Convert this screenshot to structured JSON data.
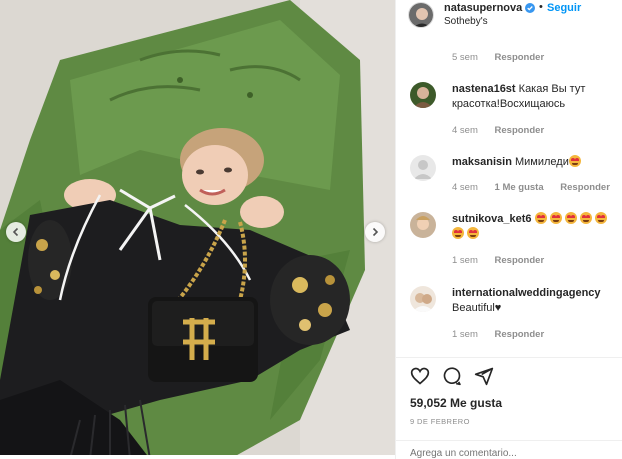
{
  "header": {
    "username": "natasupernova",
    "follow_label": "Seguir",
    "separator": "•",
    "location": "Sotheby's"
  },
  "caption_meta": {
    "time": "5 sem",
    "reply": "Responder"
  },
  "comments": [
    {
      "username": "nastena16st",
      "text": "Какая Вы тут красотка!Восхищаюсь",
      "time": "4 sem",
      "reply": "Responder"
    },
    {
      "username": "maksanisin",
      "text": "Мимиледи",
      "time": "4 sem",
      "likes": "1 Me gusta",
      "reply": "Responder"
    },
    {
      "username": "sutnikova_ket6",
      "text": "",
      "time": "1 sem",
      "reply": "Responder"
    },
    {
      "username": "internationalweddingagency",
      "text": "Beautiful♥",
      "time": "1 sem",
      "reply": "Responder"
    }
  ],
  "likes_count": "59,052 Me gusta",
  "post_date": "9 DE FEBRERO",
  "comment_input": {
    "placeholder": "Agrega un comentario..."
  },
  "icons": [
    "verified-badge-icon",
    "heart-icon",
    "comment-icon",
    "share-icon",
    "chevron-left-icon",
    "chevron-right-icon",
    "heart-eyes-emoji"
  ],
  "colors": {
    "accent": "#0095f6",
    "text": "#262626",
    "secondary": "#8e8e8e",
    "sofa": "#5f8a43"
  }
}
